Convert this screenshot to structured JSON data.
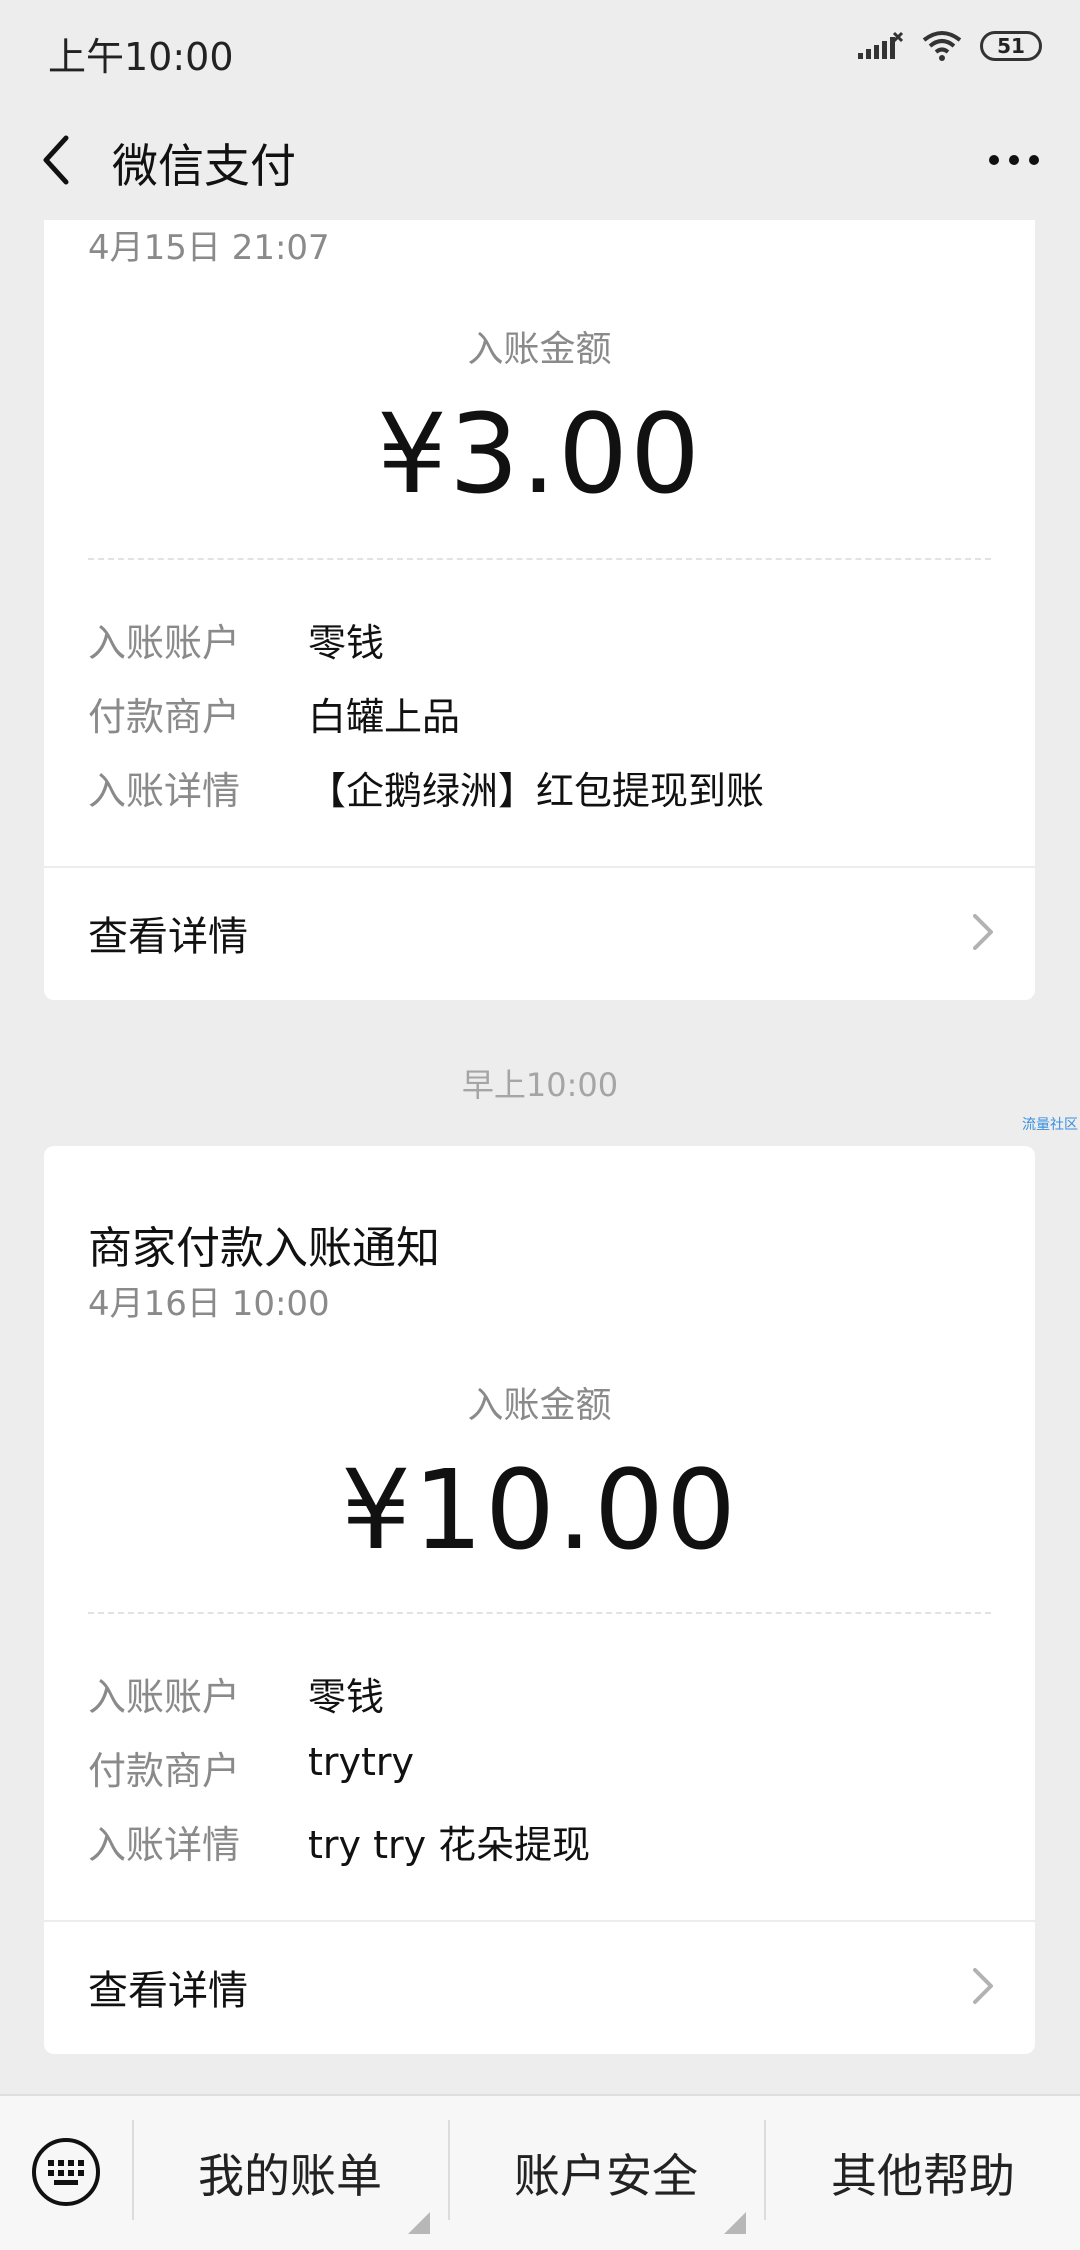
{
  "status_bar": {
    "time": "上午10:00",
    "battery": "51"
  },
  "nav": {
    "title": "微信支付"
  },
  "card1": {
    "date": "4月15日  21:07",
    "amount_label": "入账金额",
    "amount": "¥3.00",
    "rows": [
      {
        "key": "入账账户",
        "value": "零钱"
      },
      {
        "key": "付款商户",
        "value": "白罐上品"
      },
      {
        "key": "入账详情",
        "value": "【企鹅绿洲】红包提现到账"
      }
    ],
    "detail_label": "查看详情"
  },
  "time_separator": "早上10:00",
  "watermark": "流量社区",
  "card2": {
    "title": "商家付款入账通知",
    "date": "4月16日  10:00",
    "amount_label": "入账金额",
    "amount": "¥10.00",
    "rows": [
      {
        "key": "入账账户",
        "value": "零钱"
      },
      {
        "key": "付款商户",
        "value": "trytry"
      },
      {
        "key": "入账详情",
        "value": "try try 花朵提现"
      }
    ],
    "detail_label": "查看详情"
  },
  "bottom_menu": {
    "items": [
      {
        "label": "我的账单"
      },
      {
        "label": "账户安全"
      },
      {
        "label": "其他帮助"
      }
    ]
  },
  "icons": [
    "signal-icon",
    "wifi-icon",
    "battery-icon",
    "back-arrow-icon",
    "more-icon",
    "chevron-right-icon",
    "keyboard-icon"
  ]
}
